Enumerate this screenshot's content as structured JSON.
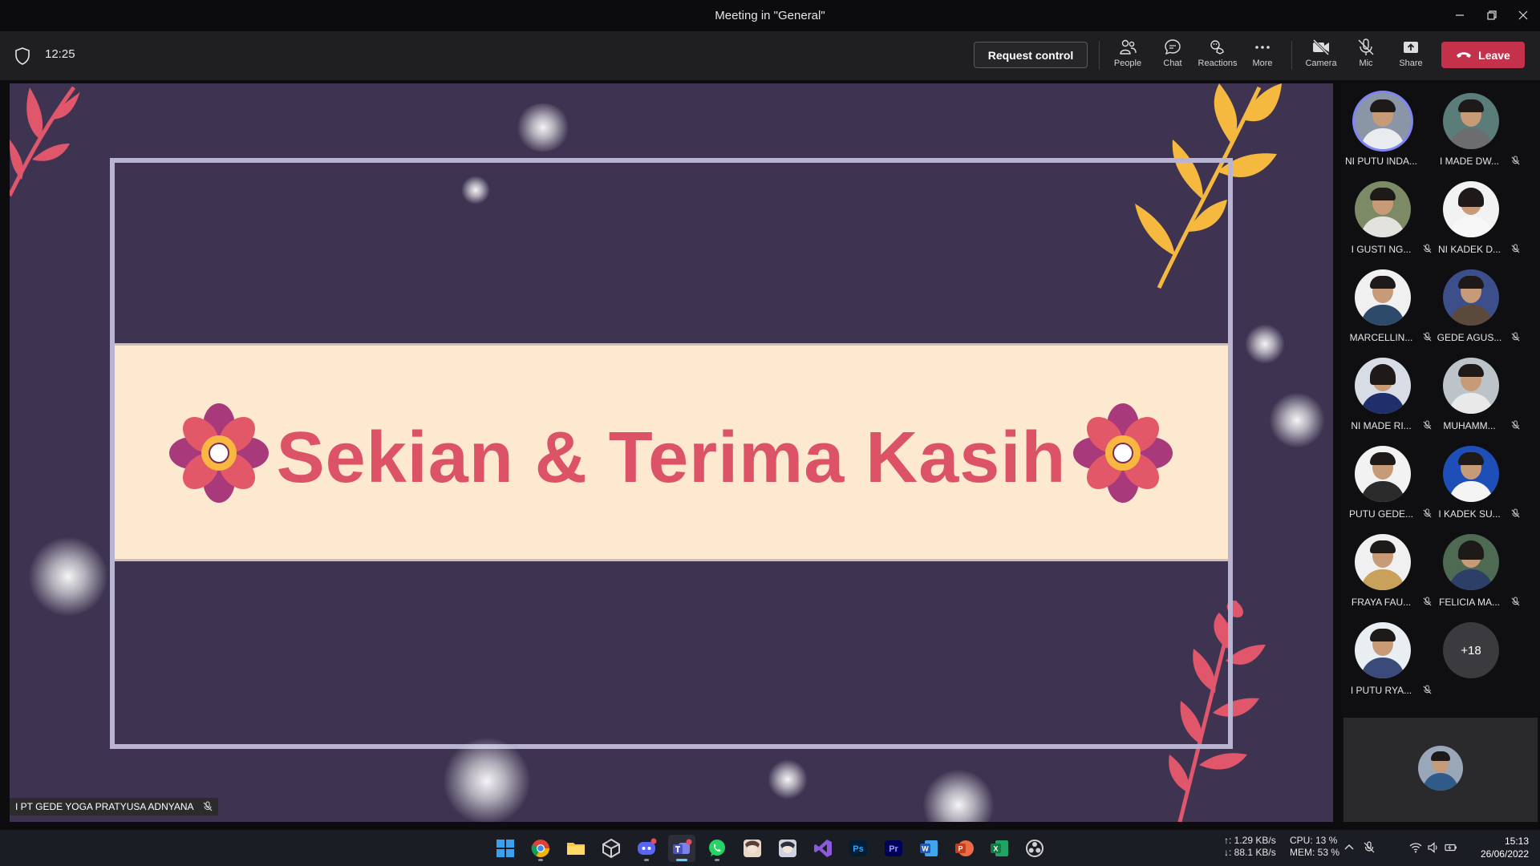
{
  "window": {
    "title": "Meeting in \"General\""
  },
  "toolbar": {
    "timer": "12:25",
    "request_control": "Request control",
    "tools": {
      "people": "People",
      "chat": "Chat",
      "reactions": "Reactions",
      "more": "More",
      "camera": "Camera",
      "mic": "Mic",
      "share": "Share"
    },
    "leave": "Leave"
  },
  "slide": {
    "title": "Sekian & Terima Kasih",
    "presenter": "I PT GEDE YOGA PRATYUSA ADNYANA"
  },
  "participants": [
    {
      "name": "NI PUTU INDA...",
      "muted": false
    },
    {
      "name": "I MADE DW...",
      "muted": true
    },
    {
      "name": "I GUSTI NG...",
      "muted": true
    },
    {
      "name": "NI KADEK D...",
      "muted": true
    },
    {
      "name": "MARCELLIN...",
      "muted": true
    },
    {
      "name": "GEDE AGUS...",
      "muted": true
    },
    {
      "name": "NI MADE RI...",
      "muted": true
    },
    {
      "name": "MUHAMM...",
      "muted": true
    },
    {
      "name": "PUTU GEDE...",
      "muted": true
    },
    {
      "name": "I KADEK SU...",
      "muted": true
    },
    {
      "name": "FRAYA FAU...",
      "muted": true
    },
    {
      "name": "FELICIA MA...",
      "muted": true
    },
    {
      "name": "I PUTU RYA...",
      "muted": true
    }
  ],
  "more_participants": "+18",
  "taskbar": {
    "apps": [
      "start",
      "chrome",
      "file-explorer",
      "unity",
      "discord",
      "teams",
      "whatsapp",
      "app-anime-1",
      "app-anime-2",
      "visual-studio",
      "photoshop",
      "premiere-pro",
      "word",
      "powerpoint",
      "excel",
      "obs"
    ],
    "net_up": "↑: 1.29 KB/s",
    "net_down": "↓: 88.1 KB/s",
    "cpu": "CPU: 13 %",
    "mem": "MEM: 53 %",
    "time": "15:13",
    "date": "26/06/2022"
  },
  "colors": {
    "stage_bg": "#3e3452",
    "banner_bg": "#fde9cf",
    "banner_text": "#dc5266",
    "leave": "#c4314b",
    "speaking_ring": "#7f85f5"
  }
}
